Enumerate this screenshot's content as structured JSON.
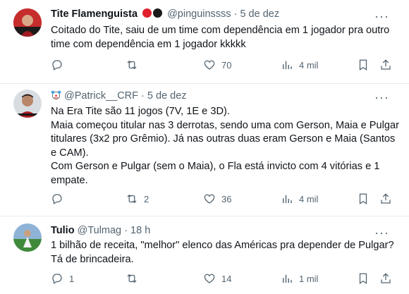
{
  "tweets": [
    {
      "name": "Tite Flamenguista",
      "handle": "@pinguinssss",
      "dot": "·",
      "date": "5 de dez",
      "more": "···",
      "text": "Coitado do Tite, saiu de um time com dependência em 1 jogador pra outro time com dependência em 1 jogador kkkkk",
      "replies": "",
      "retweets": "",
      "likes": "70",
      "views": "4 mil",
      "name_emoji_colors": [
        "#e0202c",
        "#1a1a1a"
      ]
    },
    {
      "name": "",
      "handle": "@Patrick__CRF",
      "dot": "·",
      "date": "5 de dez",
      "more": "···",
      "text": "Na Era Tite são 11 jogos (7V, 1E e 3D).\nMaia começou titular nas 3 derrotas, sendo uma com Gerson, Maia e Pulgar titulares (3x2 pro Grêmio). Já nas outras duas eram Gerson e Maia (Santos e CAM).\nCom Gerson e Pulgar (sem o Maia), o Fla está invicto com 4 vitórias e 1 empate.",
      "replies": "",
      "retweets": "2",
      "likes": "36",
      "views": "4 mil",
      "prefix_emoji": "clown-face"
    },
    {
      "name": "Tulio",
      "handle": "@Tulmag",
      "dot": "·",
      "date": "18 h",
      "more": "···",
      "text": "1 bilhão de receita, \"melhor\"  elenco das Américas pra depender de Pulgar? Tá de brincadeira.",
      "replies": "1",
      "retweets": "",
      "likes": "14",
      "views": "1 mil"
    }
  ],
  "colors": {
    "text": "#0f1419",
    "muted": "#536471",
    "divider": "#e8ecef"
  }
}
